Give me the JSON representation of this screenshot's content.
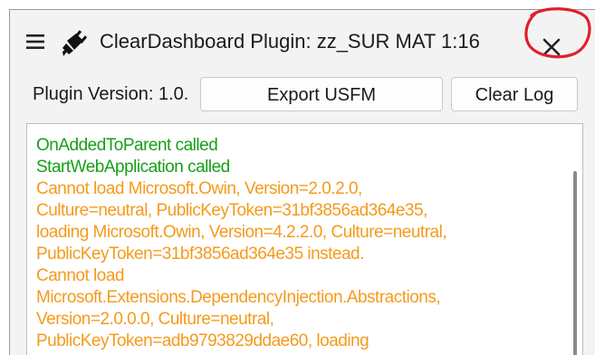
{
  "window": {
    "title": "ClearDashboard Plugin: zz_SUR MAT 1:16",
    "menu_icon": "hamburger-menu-icon",
    "app_icon": "plugin-icon",
    "close_icon": "close-icon"
  },
  "toolbar": {
    "version_label": "Plugin Version: 1.0.",
    "export_label": "Export USFM",
    "clear_label": "Clear Log"
  },
  "log": {
    "lines": [
      {
        "text": "OnAddedToParent called",
        "level": "info"
      },
      {
        "text": "StartWebApplication called",
        "level": "info"
      },
      {
        "text": "Cannot load Microsoft.Owin, Version=2.0.2.0,",
        "level": "warning"
      },
      {
        "text": "Culture=neutral, PublicKeyToken=31bf3856ad364e35,",
        "level": "warning"
      },
      {
        "text": "loading Microsoft.Owin, Version=4.2.2.0, Culture=neutral,",
        "level": "warning"
      },
      {
        "text": "PublicKeyToken=31bf3856ad364e35 instead.",
        "level": "warning"
      },
      {
        "text": "Cannot load",
        "level": "warning"
      },
      {
        "text": "Microsoft.Extensions.DependencyInjection.Abstractions,",
        "level": "warning"
      },
      {
        "text": "Version=2.0.0.0, Culture=neutral,",
        "level": "warning"
      },
      {
        "text": "PublicKeyToken=adb9793829ddae60, loading",
        "level": "warning"
      }
    ]
  },
  "colors": {
    "info": "#16a016",
    "warning": "#f59a1b",
    "annotation": "#e0202c"
  }
}
